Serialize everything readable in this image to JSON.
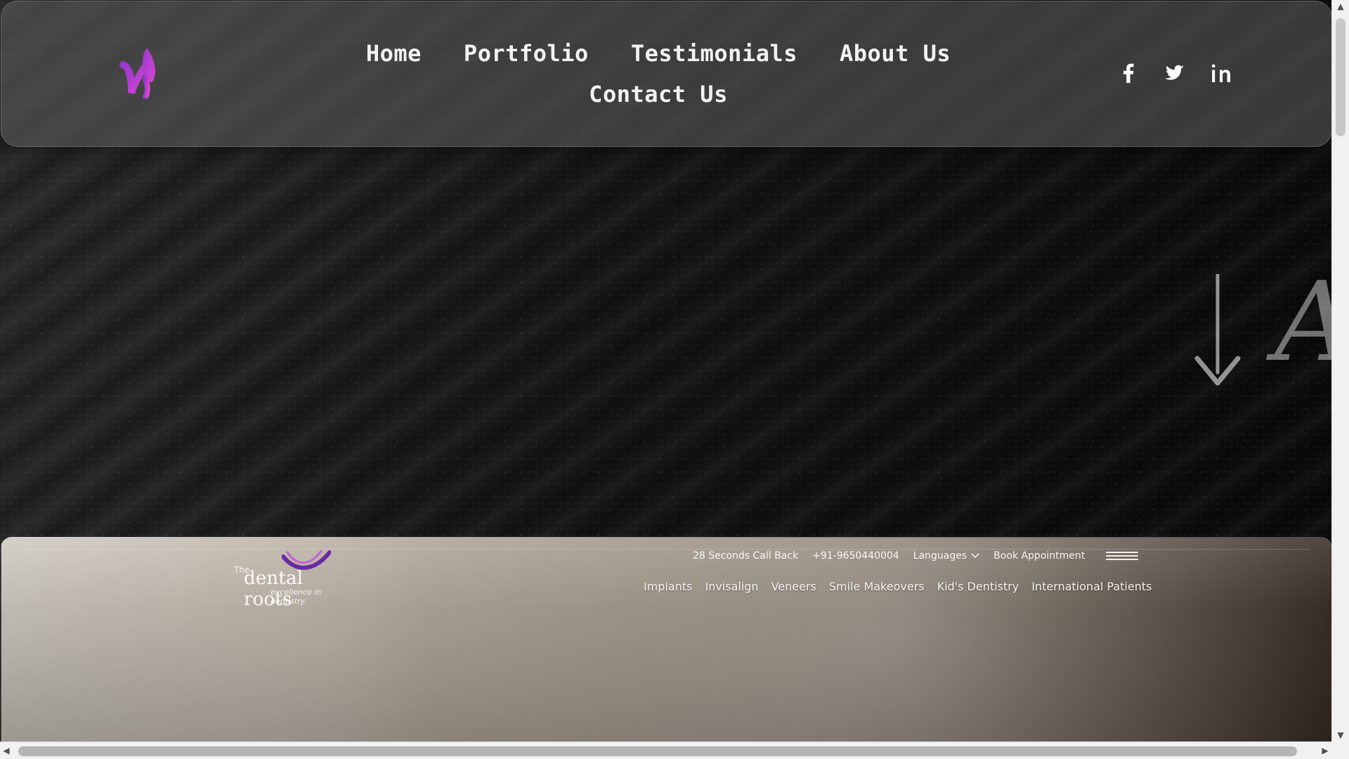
{
  "top_nav": {
    "items": [
      {
        "label": "Home"
      },
      {
        "label": "Portfolio"
      },
      {
        "label": "Testimonials"
      },
      {
        "label": "About Us"
      },
      {
        "label": "Contact Us"
      }
    ]
  },
  "social": {
    "items": [
      {
        "name": "facebook-icon"
      },
      {
        "name": "twitter-icon"
      },
      {
        "name": "linkedin-icon"
      }
    ]
  },
  "hero": {
    "decorative_letter": "A",
    "arrow_icon": "down-arrow-icon"
  },
  "preview": {
    "logo": {
      "prefix": "The",
      "name": "dental roots",
      "tagline": "excellence in dentistry"
    },
    "meta": {
      "callback": "28 Seconds Call Back",
      "phone": "+91-9650440004",
      "languages": "Languages",
      "book": "Book Appointment"
    },
    "nav": [
      "Implants",
      "Invisalign",
      "Veneers",
      "Smile Makeovers",
      "Kid's Dentistry",
      "International Patients"
    ]
  },
  "colors": {
    "brand_purple": "#7b2fb3",
    "brand_pink": "#d24ad0",
    "nav_text": "#f2f2f2"
  }
}
